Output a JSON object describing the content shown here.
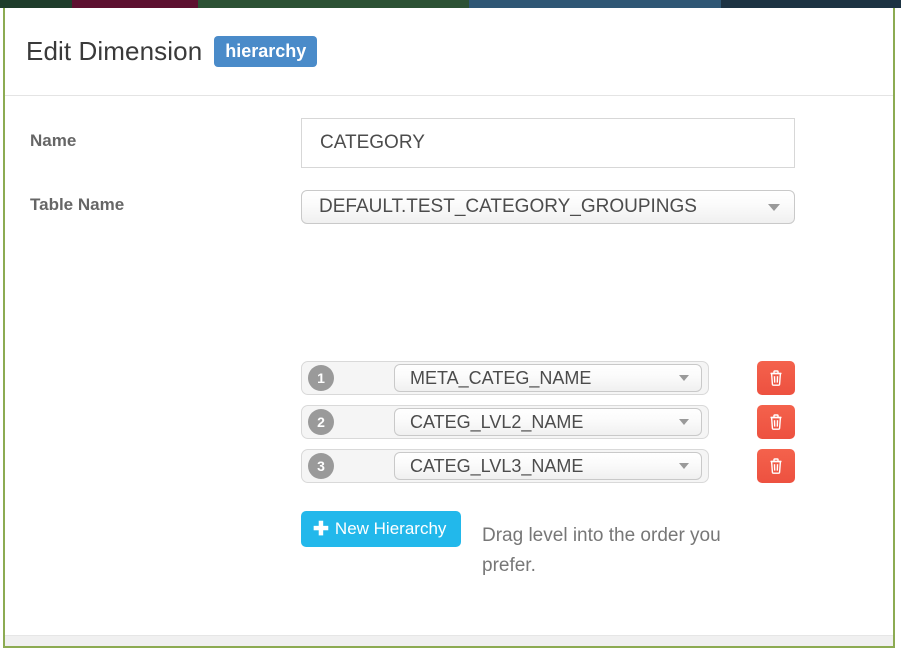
{
  "window": {
    "top_strip_segments": [
      {
        "name": "strip-segment-dark-green",
        "color": "#1f3d2b",
        "width_pct": 8
      },
      {
        "name": "strip-segment-maroon",
        "color": "#5d1030",
        "width_pct": 14
      },
      {
        "name": "strip-segment-green",
        "color": "#2c5134",
        "width_pct": 30
      },
      {
        "name": "strip-segment-steel-blue",
        "color": "#2f5775",
        "width_pct": 28
      },
      {
        "name": "strip-segment-dark",
        "color": "#1d3343",
        "width_pct": 20
      }
    ],
    "border_color": "#8cab52",
    "footer_color": "#f0f0f0"
  },
  "header": {
    "title": "Edit Dimension",
    "badge": "hierarchy",
    "badge_color": "#4a8bc9"
  },
  "form": {
    "name_field": {
      "label": "Name",
      "value": "CATEGORY",
      "placeholder": "Name"
    },
    "table_name_field": {
      "label": "Table Name",
      "value": "DEFAULT.TEST_CATEGORY_GROUPINGS",
      "caret_icon": "chevron-down-icon"
    }
  },
  "hierarchy": {
    "levels": [
      {
        "order": "1",
        "column": "META_CATEG_NAME",
        "delete_icon": "trash-icon"
      },
      {
        "order": "2",
        "column": "CATEG_LVL2_NAME",
        "delete_icon": "trash-icon"
      },
      {
        "order": "3",
        "column": "CATEG_LVL3_NAME",
        "delete_icon": "trash-icon"
      }
    ],
    "new_button": {
      "plus_glyph": "✚",
      "label": "New Hierarchy",
      "color": "#22b8eb"
    },
    "hint": "Drag level into the order you prefer.",
    "delete_button_color": "#f15b46",
    "badge_color": "#9a9a9a"
  }
}
